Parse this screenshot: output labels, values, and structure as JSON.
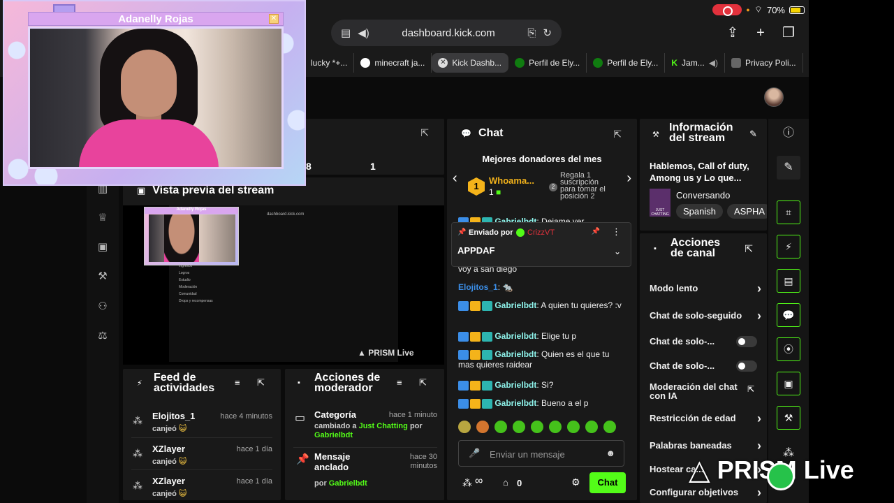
{
  "status_bar": {
    "battery": "70%"
  },
  "browser": {
    "url": "dashboard.kick.com",
    "tabs": [
      {
        "label": "lucky *+..."
      },
      {
        "label": "minecraft ja..."
      },
      {
        "label": "Kick Dashb..."
      },
      {
        "label": "Perfil de Ely..."
      },
      {
        "label": "Perfil de Ely..."
      },
      {
        "label": "Jam..."
      },
      {
        "label": "Privacy Poli..."
      }
    ]
  },
  "webcam": {
    "title": "Adanelly Rojas"
  },
  "stats": {
    "value_a": "8",
    "value_b": "1"
  },
  "preview": {
    "title": "Vista previa del stream",
    "mini_url": "dashboard.kick.com",
    "mini_title": "Adanelly Rojas",
    "mini_menu": [
      "Ingresos",
      "Logros",
      "Estudio",
      "Moderación",
      "Comunidad",
      "Drops y recompensas"
    ],
    "watermark": "PRISM Live"
  },
  "feed": {
    "title_line1": "Feed de",
    "title_line2": "actividades",
    "items": [
      {
        "user": "Elojitos_1",
        "time": "hace 4 minutos",
        "action": "canjeó"
      },
      {
        "user": "XZlayer",
        "time": "hace 1 día",
        "action": "canjeó"
      },
      {
        "user": "XZlayer",
        "time": "hace 1 día",
        "action": "canjeó"
      }
    ]
  },
  "moderator": {
    "title_line1": "Acciones de",
    "title_line2": "moderador",
    "items": [
      {
        "title": "Categoría",
        "time": "hace 1 minuto",
        "desc_prefix": "cambiado a",
        "desc_highlight": "Just Chatting",
        "desc_suffix": "por",
        "by": "Gabrielbdt"
      },
      {
        "title_line1": "Mensaje",
        "title_line2": "anclado",
        "time_line1": "hace 30",
        "time_line2": "minutos",
        "desc_prefix": "por",
        "by": "Gabrielbdt"
      }
    ]
  },
  "chat": {
    "title": "Chat",
    "donors_title": "Mejores donadores del mes",
    "top_donor": {
      "rank": "1",
      "name": "Whoama...",
      "count": "1"
    },
    "gift_text": "Regala 1 suscripción para tomar el posición 2",
    "gift_rank": "2",
    "pinned": {
      "sent_by_label": "Enviado por",
      "sender": "CrizzVT",
      "text": "APPDAF"
    },
    "messages": [
      {
        "user": "Gabrielbdt",
        "text": "Dejame ver"
      },
      {
        "user": "",
        "text": "voy a san diego"
      },
      {
        "user": "Elojitos_1",
        "text": ""
      },
      {
        "user": "Gabrielbdt",
        "text": "A quien tu quieres? :v"
      },
      {
        "user": "Gabrielbdt",
        "text": "Elige tu p"
      },
      {
        "user": "Gabrielbdt",
        "text": "Quien es el que tu mas quieres raidear"
      },
      {
        "user": "Gabrielbdt",
        "text": "Si?"
      },
      {
        "user": "Gabrielbdt",
        "text": "Bueno a el p"
      }
    ],
    "input_placeholder": "Enviar un mensaje",
    "points": "∞",
    "gifts_count": "0",
    "send_label": "Chat"
  },
  "stream_info": {
    "title_line1": "Información",
    "title_line2": "del stream",
    "stream_title": "Hablemos, Call of duty, Among us y Lo que...",
    "category": "Conversando",
    "category_art": "JUST CHATTING",
    "tags": [
      "Spanish",
      "ASPHA"
    ]
  },
  "channel_actions": {
    "title_line1": "Acciones",
    "title_line2": "de canal",
    "items": [
      {
        "label": "Modo lento",
        "control": "chevron"
      },
      {
        "label": "Chat de solo-seguido",
        "control": "chevron"
      },
      {
        "label": "Chat de solo-...",
        "control": "toggle"
      },
      {
        "label": "Chat de solo-...",
        "control": "toggle"
      },
      {
        "label": "Moderación del chat con IA",
        "control": "external"
      },
      {
        "label": "Restricción de edad",
        "control": "chevron"
      },
      {
        "label": "Palabras baneadas",
        "control": "chevron"
      },
      {
        "label": "Hostear ca...",
        "control": "chevron"
      },
      {
        "label": "Configurar objetivos",
        "control": "chevron"
      }
    ]
  },
  "overlay": {
    "brand": "PRISM Live"
  },
  "colors": {
    "accent": "#53fc18",
    "panel": "#191919",
    "background": "#0b0b0b"
  }
}
